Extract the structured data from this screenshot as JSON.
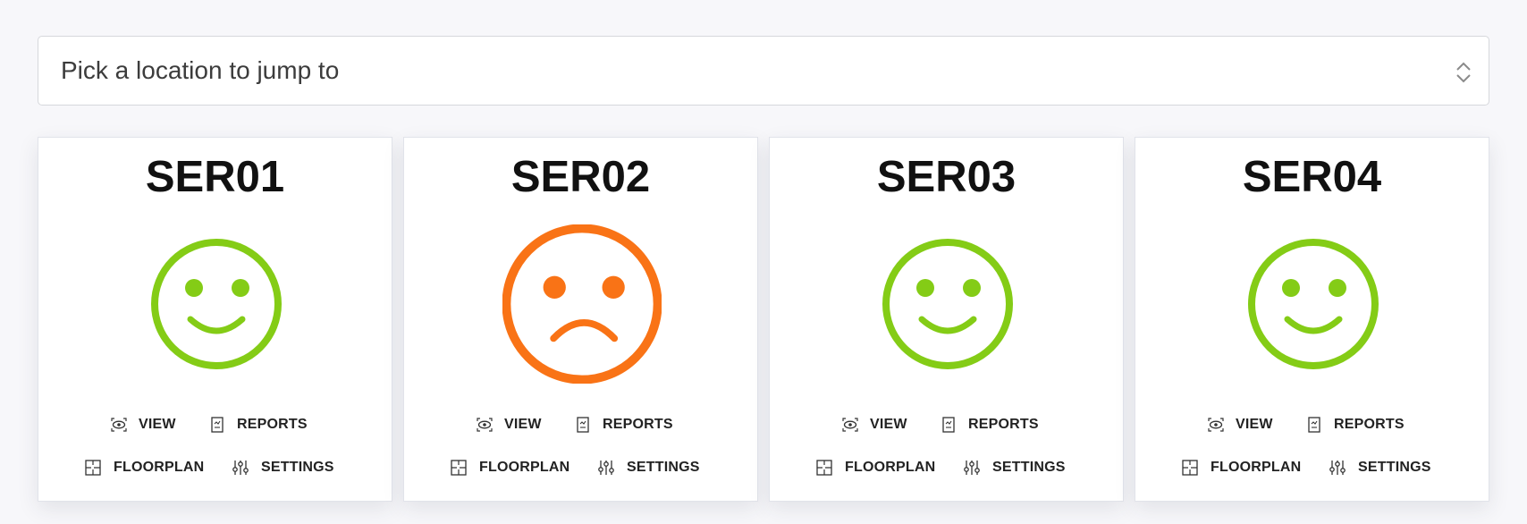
{
  "location_picker": {
    "placeholder": "Pick a location to jump to"
  },
  "colors": {
    "ok": "#84cc16",
    "warning": "#f97316"
  },
  "actions": {
    "view": "VIEW",
    "reports": "REPORTS",
    "floorplan": "FLOORPLAN",
    "settings": "SETTINGS"
  },
  "cards": [
    {
      "name": "SER01",
      "status": "happy",
      "status_color": "#84cc16"
    },
    {
      "name": "SER02",
      "status": "sad",
      "status_color": "#f97316"
    },
    {
      "name": "SER03",
      "status": "happy",
      "status_color": "#84cc16"
    },
    {
      "name": "SER04",
      "status": "happy",
      "status_color": "#84cc16"
    }
  ],
  "icons": {
    "view": "eye-icon",
    "reports": "report-icon",
    "floorplan": "floorplan-icon",
    "settings": "sliders-icon",
    "picker": "chevron-up-down-icon"
  }
}
